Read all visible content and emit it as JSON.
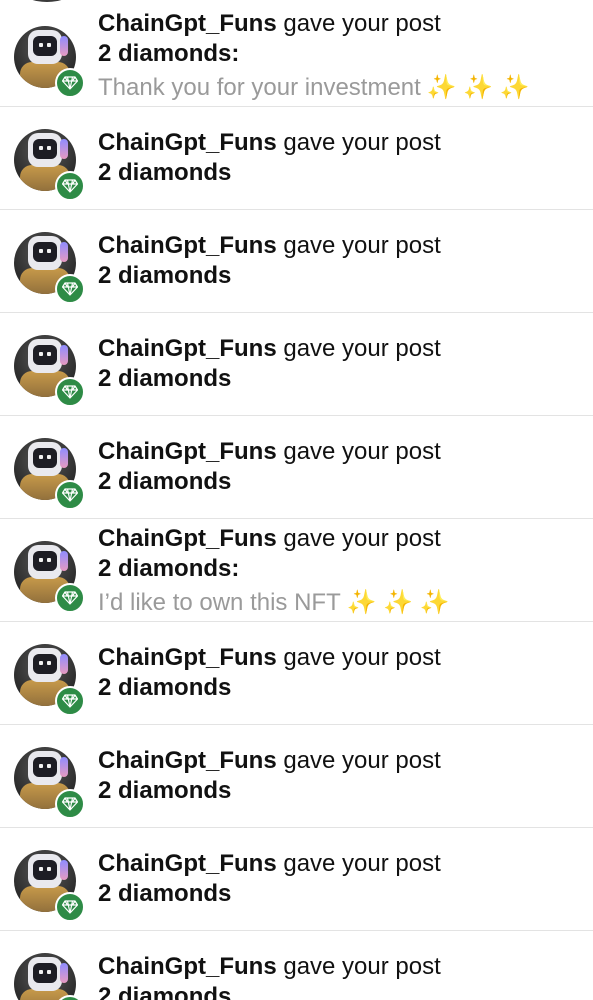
{
  "notifications": [
    {
      "user": "ChainGpt_Funs",
      "action": "gave your post",
      "amount": "2 diamonds:",
      "comment": "Thank you for your investment",
      "emoji": "✨ ✨ ✨"
    },
    {
      "user": "ChainGpt_Funs",
      "action": "gave your post",
      "amount": "2 diamonds"
    },
    {
      "user": "ChainGpt_Funs",
      "action": "gave your post",
      "amount": "2 diamonds"
    },
    {
      "user": "ChainGpt_Funs",
      "action": "gave your post",
      "amount": "2 diamonds"
    },
    {
      "user": "ChainGpt_Funs",
      "action": "gave your post",
      "amount": "2 diamonds"
    },
    {
      "user": "ChainGpt_Funs",
      "action": "gave your post",
      "amount": "2 diamonds:",
      "comment": "I’d like to own this NFT",
      "emoji": "✨ ✨ ✨"
    },
    {
      "user": "ChainGpt_Funs",
      "action": "gave your post",
      "amount": "2 diamonds"
    },
    {
      "user": "ChainGpt_Funs",
      "action": "gave your post",
      "amount": "2 diamonds"
    },
    {
      "user": "ChainGpt_Funs",
      "action": "gave your post",
      "amount": "2 diamonds"
    },
    {
      "user": "ChainGpt_Funs",
      "action": "gave your post",
      "amount": "2 diamonds"
    }
  ],
  "icons": {
    "badge": "diamond-icon",
    "avatar": "robot-avatar"
  },
  "colors": {
    "badge": "#2e8b46",
    "comment": "#9a9a9a",
    "sparkle": "#e5bf3f",
    "divider": "#e3e3e3"
  }
}
